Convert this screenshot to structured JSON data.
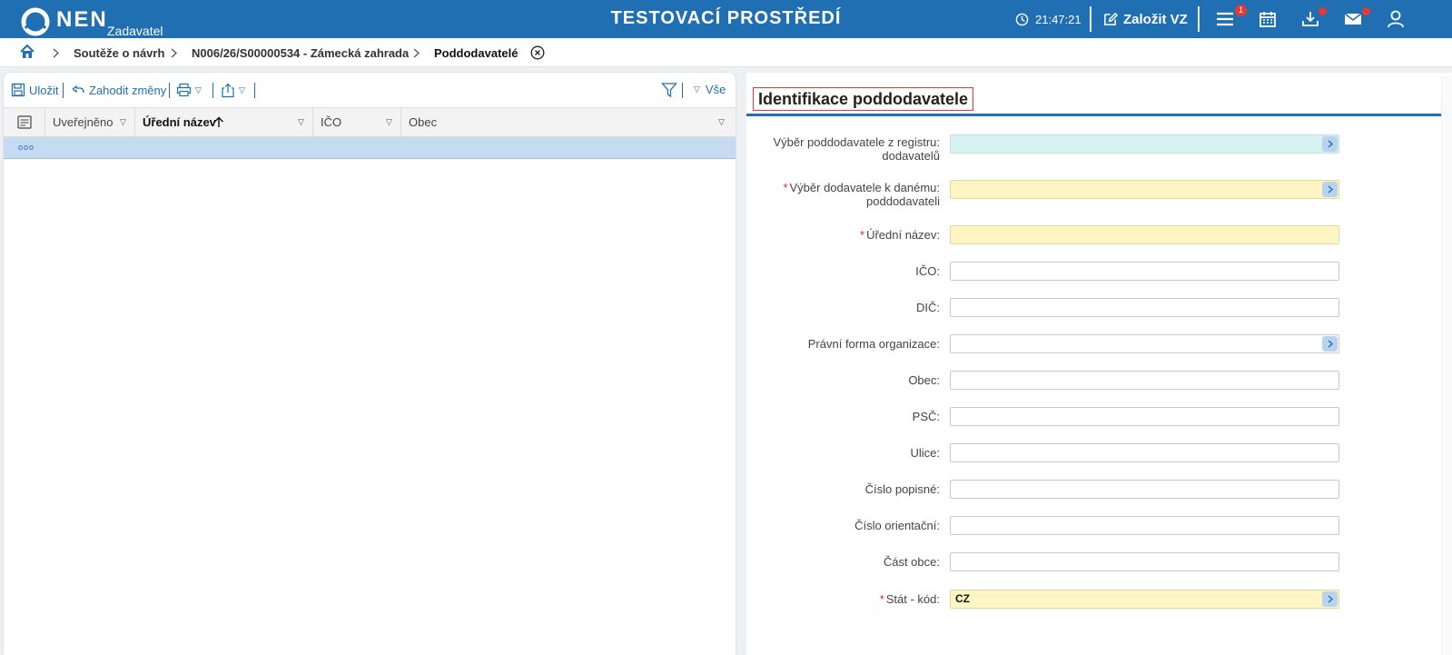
{
  "app": {
    "logo_text": "NEN",
    "logo_sub": "Zadavatel",
    "env_title": "TESTOVACÍ PROSTŘEDÍ",
    "time": "21:47:21",
    "create_label": "Založit VZ",
    "notification_count": "1"
  },
  "breadcrumb": {
    "items": [
      "Soutěže o návrh",
      "N006/26/S00000534 - Zámecká zahrada",
      "Poddodavatelé"
    ]
  },
  "toolbar": {
    "save_label": "Uložit",
    "discard_label": "Zahodit změny",
    "filter_all_label": "Vše"
  },
  "grid": {
    "columns": [
      "Uveřejněno",
      "Úřední název",
      "IČO",
      "Obec"
    ],
    "sorted_column": "Úřední název",
    "row_marker": "ooo"
  },
  "form": {
    "title": "Identifikace poddodavatele",
    "fields": [
      {
        "label": "Výběr poddodavatele z registru: dodavatelů",
        "line1": "Výběr poddodavatele z registru:",
        "line2": "dodavatelů",
        "value": "",
        "required": false,
        "style": "cyan",
        "picker": true
      },
      {
        "label": "Výběr dodavatele k danému: poddodavateli",
        "line1": "Výběr dodavatele k danému:",
        "line2": "poddodavateli",
        "value": "",
        "required": true,
        "style": "yellow",
        "picker": true
      },
      {
        "label": "Úřední název:",
        "value": "",
        "required": true,
        "style": "yellow",
        "picker": false
      },
      {
        "label": "IČO:",
        "value": "",
        "required": false,
        "style": "plain",
        "picker": false
      },
      {
        "label": "DIČ:",
        "value": "",
        "required": false,
        "style": "plain",
        "picker": false
      },
      {
        "label": "Právní forma organizace:",
        "value": "",
        "required": false,
        "style": "plain",
        "picker": true
      },
      {
        "label": "Obec:",
        "value": "",
        "required": false,
        "style": "plain",
        "picker": false
      },
      {
        "label": "PSČ:",
        "value": "",
        "required": false,
        "style": "plain",
        "picker": false
      },
      {
        "label": "Ulice:",
        "value": "",
        "required": false,
        "style": "plain",
        "picker": false
      },
      {
        "label": "Číslo popisné:",
        "value": "",
        "required": false,
        "style": "plain",
        "picker": false
      },
      {
        "label": "Číslo orientační:",
        "value": "",
        "required": false,
        "style": "plain",
        "picker": false
      },
      {
        "label": "Část obce:",
        "value": "",
        "required": false,
        "style": "plain",
        "picker": false
      },
      {
        "label": "Stát - kód:",
        "value": "CZ",
        "required": true,
        "style": "yellow",
        "picker": true
      }
    ]
  },
  "colors": {
    "brand_blue": "#1f6fb2",
    "required_red": "#d32f2f",
    "row_selected": "#c6daf2",
    "field_yellow": "#fdf6c4",
    "field_cyan": "#d8f2f2"
  },
  "icons": [
    "logo-icon",
    "clock-icon",
    "edit-icon",
    "menu-icon",
    "calendar-icon",
    "download-icon",
    "mail-icon",
    "user-icon",
    "home-icon",
    "chevron-right-icon",
    "close-circle-icon",
    "save-icon",
    "undo-icon",
    "print-icon",
    "export-icon",
    "filter-icon",
    "column-settings-icon",
    "picker-chevron-icon"
  ]
}
